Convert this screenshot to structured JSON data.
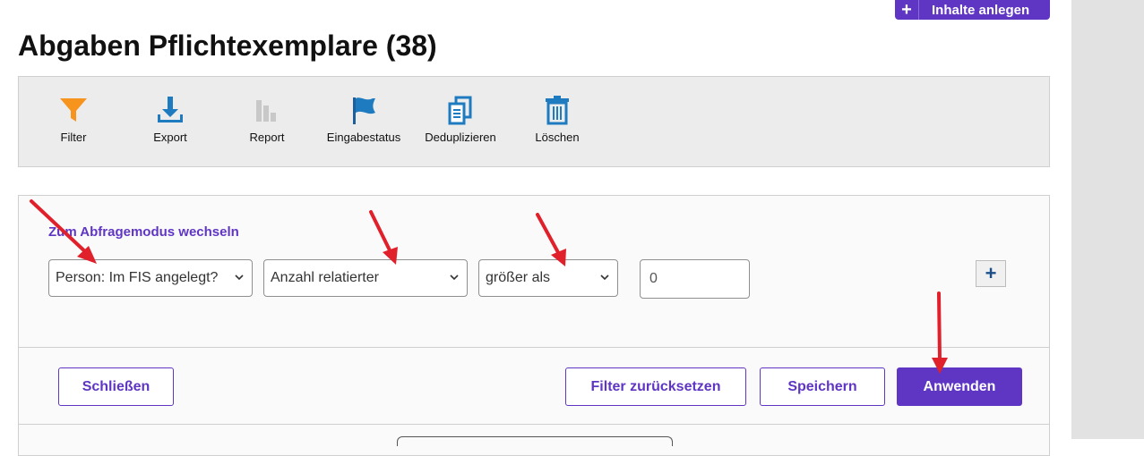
{
  "header": {
    "add_button_label": "Inhalte anlegen",
    "title": "Abgaben Pflichtexemplare (38)"
  },
  "toolbar": {
    "items": [
      {
        "label": "Filter",
        "icon": "filter-icon"
      },
      {
        "label": "Export",
        "icon": "download-icon"
      },
      {
        "label": "Report",
        "icon": "bar-chart-icon"
      },
      {
        "label": "Eingabestatus",
        "icon": "flag-icon"
      },
      {
        "label": "Deduplizieren",
        "icon": "copy-icon"
      },
      {
        "label": "Löschen",
        "icon": "trash-icon"
      }
    ]
  },
  "filter_panel": {
    "mode_link": "Zum Abfragemodus wechseln",
    "field_select": "Person: Im FIS angelegt?",
    "attribute_select": "Anzahl relatierter",
    "operator_select": "größer als",
    "value_input": "0",
    "add_row_label": "+"
  },
  "actions": {
    "close": "Schließen",
    "reset": "Filter zurücksetzen",
    "save": "Speichern",
    "apply": "Anwenden"
  },
  "colors": {
    "accent": "#5f35c4",
    "annotation_arrow": "#e0202a",
    "filter_icon": "#f7941d",
    "toolbar_icons": "#1f7bc0"
  }
}
